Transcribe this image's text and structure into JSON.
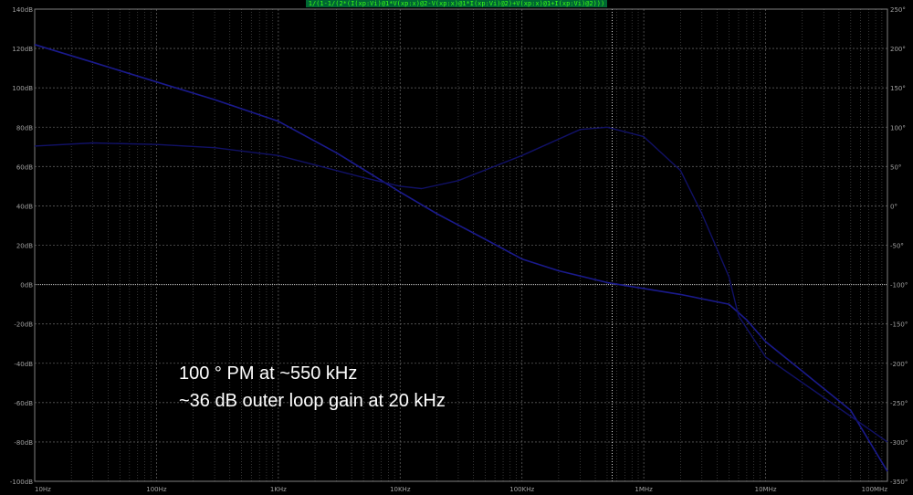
{
  "trace_expression": "1/(1-1/(2*(I(xp:Vi)@1*V(xp:x)@2-V(xp:x)@1*I(xp:Vi)@2)+V(xp:x)@1+I(xp:Vi)@2)))",
  "annotations": [
    "100 ° PM at ~550 kHz",
    "~36 dB outer loop gain at 20 kHz"
  ],
  "colors": {
    "background": "#000000",
    "grid": "#5a5a5a",
    "zero_line": "#c8c8c8",
    "axis_text": "#a0a0a0",
    "trace_gain": "#1a1a8c",
    "trace_phase": "#111166",
    "title_text": "#39ff14",
    "annotation_text": "#ffffff"
  },
  "chart_data": {
    "type": "line",
    "x_scale": "log",
    "xlim": [
      10,
      100000000
    ],
    "x_ticks": [
      10,
      100,
      1000,
      10000,
      100000,
      1000000,
      10000000,
      100000000
    ],
    "x_tick_labels": [
      "10Hz",
      "100Hz",
      "1KHz",
      "10KHz",
      "100KHz",
      "1MHz",
      "10MHz",
      "100MHz"
    ],
    "ylim_left": [
      -100,
      140
    ],
    "y_ticks_left": [
      140,
      120,
      100,
      80,
      60,
      40,
      20,
      0,
      -20,
      -40,
      -60,
      -80,
      -100
    ],
    "y_tick_labels_left": [
      "140dB",
      "120dB",
      "100dB",
      "80dB",
      "60dB",
      "40dB",
      "20dB",
      "0dB",
      "-20dB",
      "-40dB",
      "-60dB",
      "-80dB",
      "-100dB"
    ],
    "ylim_right": [
      -350,
      250
    ],
    "y_ticks_right": [
      250,
      200,
      150,
      100,
      50,
      0,
      -50,
      -100,
      -150,
      -200,
      -250,
      -300,
      -350
    ],
    "y_tick_labels_right": [
      "250°",
      "200°",
      "150°",
      "100°",
      "50°",
      "0°",
      "-50°",
      "-100°",
      "-150°",
      "-200°",
      "-250°",
      "-300°",
      "-350°"
    ],
    "grid": true,
    "cursor_x": 550000,
    "series": [
      {
        "axis": "left",
        "x": [
          10,
          30,
          100,
          300,
          1000,
          3000,
          10000,
          20000,
          50000,
          100000,
          200000,
          500000,
          1000000,
          2000000,
          5000000,
          7000000,
          10000000,
          20000000,
          50000000,
          100000000
        ],
        "y": [
          122,
          113,
          103,
          94,
          83,
          67,
          47,
          36,
          23,
          13,
          7,
          1,
          -2,
          -5,
          -10,
          -18,
          -29,
          -44,
          -64,
          -95
        ]
      },
      {
        "axis": "right",
        "x": [
          10,
          30,
          100,
          300,
          1000,
          2000,
          5000,
          10000,
          15000,
          30000,
          100000,
          300000,
          500000,
          1000000,
          2000000,
          3000000,
          5000000,
          6000000,
          10000000,
          100000000
        ],
        "y": [
          76,
          80,
          78,
          74,
          64,
          52,
          36,
          25,
          22,
          32,
          64,
          97,
          100,
          88,
          45,
          -10,
          -90,
          -140,
          -192,
          -300
        ]
      }
    ]
  }
}
